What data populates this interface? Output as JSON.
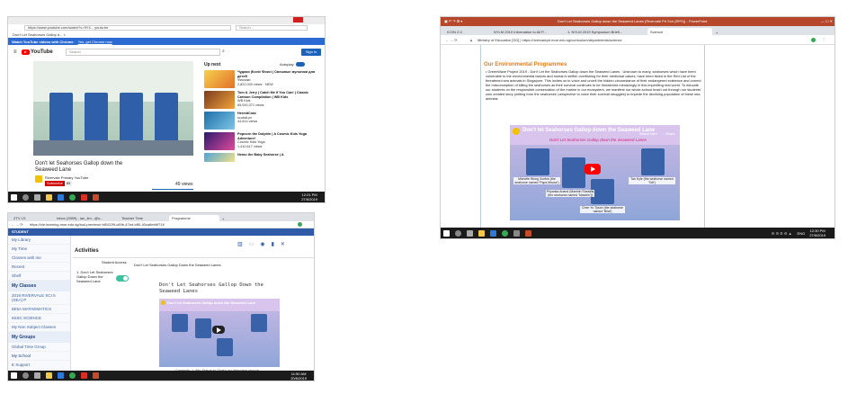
{
  "yt": {
    "tab_title": "Don't Let Seahorses Gallop d... ×",
    "url": "https://www.youtube.com/watch?v=9Y4... youtu.be",
    "search_placeholder": "Search...",
    "banner_text": "Watch YouTube videos with Chrome.",
    "banner_link": "Yes, get Chrome now",
    "logo": "YouTube",
    "search": "Search",
    "signin": "Sign in",
    "video_title": "Don't let Seahorses Gallop down the Seaweed Lane",
    "channel": "Rivervale Primary YouTube",
    "subscribe": "Subscribe",
    "sub_count": "89",
    "views": "49 views",
    "up_next": "Up next",
    "autoplay": "Autoplay",
    "recs": [
      {
        "title": "Чудики |Ković Фиксі | Смешные мультики для детей",
        "channel": "Фиксики",
        "views": "2,822,000 views · NEW"
      },
      {
        "title": "Tom & Jerry | Catch Me If You Can! | Classic Cartoon Compilation | WB Kids",
        "channel": "WB Kids",
        "views": "65,000,371 views"
      },
      {
        "title": "HermitCrab",
        "channel": "scubaLyn",
        "views": "44,814 views"
      },
      {
        "title": "Popcorn the Dolphin | A Cosmic Kids Yoga Adventure!",
        "channel": "Cosmic Kids Yoga",
        "views": "1,410,617 views"
      },
      {
        "title": "Nemo the Baby Seahorse | A",
        "channel": "",
        "views": ""
      }
    ],
    "time": "12:21 PM",
    "date": "27/6/2019"
  },
  "pp": {
    "title": "Don't Let Seahorses Gallop down the Seaweed Lanes (Rivervale Pri Sch (RPS)) - PowerPoint",
    "tabs": [
      "ICON 2.0",
      "NYLM 2019 Information to All P...",
      "1. NYLM 2019 Symposium Briefi...",
      "Science"
    ],
    "url": "Ministry of Education [SG] | https://rivervalepri.moe.edu.sg/curriculum/departments/science",
    "heading": "Our Environmental Programmes",
    "body": "GreenWave Project 2019 - Don't Let the Seahorses Gallop down the Seaweed Lanes : Unknown to many, seahorses which have been vulnerable to the environmental factors and human's selfish overfishing for their medicinal values, have been listed in the Red List of the threatened sea animals in Singapore. This incites us to voice and unveil the hidden circumstance of their endangered existence and correct the misconception of killing the seahorses as their survival continues to be threatened menacingly in this imperilling real world. To educate our students on the responsible conservation of the marine in our ecosystem, we manifest our whole-school teach out through our students' own created story (writing from the seahorses' perspective to voice their survival struggles) to impede the declining population of these sea animals.",
    "video_title": "Don't let Seahorses Gallop down the Seaweed Lane",
    "share": "Share",
    "watch_later": "Watch later",
    "video_banner": "Don't Let Seahorses Gallop down the Seaweed Lanes",
    "captions": [
      "Michelle Wong Xuebin (the seahorse named 'Papa Mouse')",
      "Priyanka Anand (Mawhin Sheaths (the seahorse named 'Mawhin'))",
      "Tan Kyle (the seahorse named 'Tofi')",
      "Chen Yu Tyson (the seahorse named 'Bilal')"
    ],
    "time": "12:30 PM",
    "lang": "ENG",
    "date": "27/6/2019"
  },
  "sls": {
    "tabs": [
      "ZTV LS",
      "Inbox (2899) - ian_lim...@s...",
      "Teacher Time",
      "Programme"
    ],
    "url": "https://vle.learning.moe.edu.sg/tool-preview/r.fdf102f9-c89b-47ed-bff0-40ca8eb6f71f/",
    "brand": "STUDENT",
    "side_top": [
      "My Library",
      "My Time",
      "Classes with me",
      "Recent",
      "Shelf"
    ],
    "my_classes": "My Classes",
    "classes": [
      "2019 RIVERVALE SCI 5 (SEA) P",
      "6E5A MATHEMATICS",
      "6SSC SCIENCE",
      "My Non Subject Classes"
    ],
    "my_groups": "My Groups",
    "groups": [
      "Global Time Group"
    ],
    "my_school": "My School",
    "school_items": [
      "E Support",
      "My Classes"
    ],
    "activities": "Activities",
    "student_access": "Student Access",
    "activity_item": "1. Don't Let Seahorses Gallop Down the Seaweed Lane",
    "crumb": "Don't Let Seahorses Gallop Down the Seaweed Lanes",
    "page_title": "Don't Let Seahorses Gallop Down the Seaweed Lanes",
    "video_title": "Don't let Seahorses Gallop down the Seaweed Lane",
    "footer": "Contexts: 1. Nis Statue to That's an Interview church",
    "time": "11:50 AM",
    "date": "20/6/2019"
  },
  "colors": {
    "yt_red": "#ff0000",
    "pp_bar": "#b7472a",
    "sls_blue": "#2e5aa7",
    "taskbar": "#1b1b1b",
    "heading_orange": "#e07c1b"
  }
}
